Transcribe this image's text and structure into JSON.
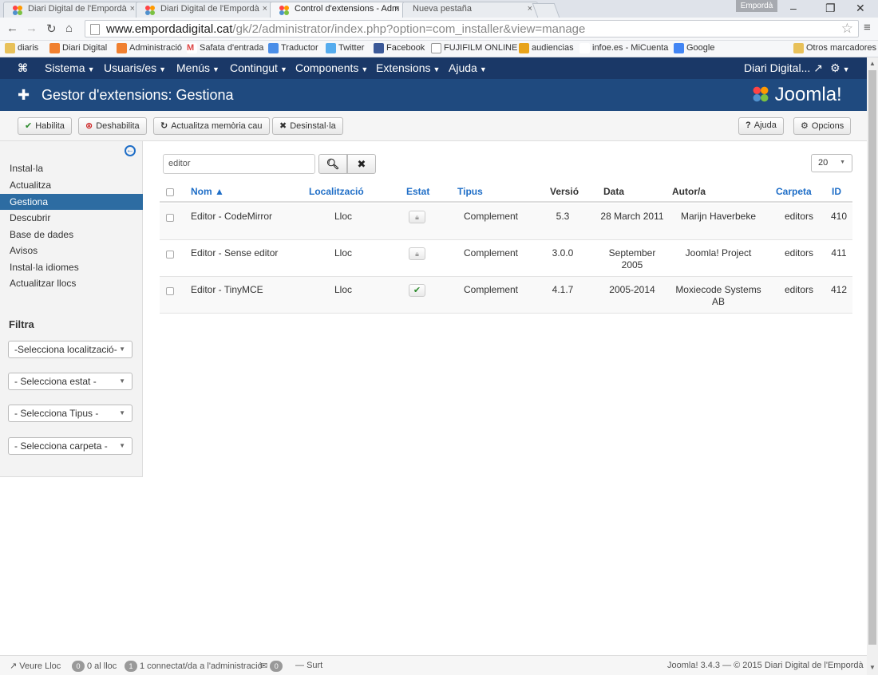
{
  "browser": {
    "tabs": [
      {
        "title": "Diari Digital de l'Empordà",
        "close": "×"
      },
      {
        "title": "Diari Digital de l'Empordà",
        "close": "×"
      },
      {
        "title": "Control d'extensions - Adm",
        "close": "×"
      },
      {
        "title": "Nueva pestaña",
        "close": "×"
      }
    ],
    "profile": "Empordà",
    "url_host": "www.empordadigital.cat",
    "url_path": "/gk/2/administrator/index.php?option=com_installer&view=manage",
    "bookmarks": [
      "diaris",
      "Diari Digital",
      "Administració",
      "Safata d'entrada",
      "Traductor",
      "Twitter",
      "Facebook",
      "FUJIFILM ONLINE",
      "audiencias",
      "infoe.es - MiCuenta",
      "Google"
    ],
    "other_bookmarks": "Otros marcadores"
  },
  "topnav": {
    "items": [
      "Sistema",
      "Usuaris/es",
      "Menús",
      "Contingut",
      "Components",
      "Extensions",
      "Ajuda"
    ],
    "site": "Diari Digital...",
    "gear": "⚙"
  },
  "header": {
    "title": "Gestor d'extensions: Gestiona",
    "logo": "Joomla!"
  },
  "toolbar": {
    "enable": "Habilita",
    "disable": "Deshabilita",
    "refresh": "Actualitza memòria cau",
    "uninstall": "Desinstal·la",
    "help": "Ajuda",
    "options": "Opcions"
  },
  "sidebar": {
    "items": [
      "Instal·la",
      "Actualitza",
      "Gestiona",
      "Descubrir",
      "Base de dades",
      "Avisos",
      "Instal·la idiomes",
      "Actualitzar llocs"
    ],
    "filter_label": "Filtra",
    "filters": [
      "-Selecciona localització-",
      "- Selecciona estat -",
      "- Selecciona Tipus -",
      "- Selecciona carpeta -"
    ]
  },
  "search": {
    "value": "editor",
    "limit": "20"
  },
  "table": {
    "headers": {
      "name": "Nom ▲",
      "location": "Localització",
      "status": "Estat",
      "type": "Tipus",
      "version": "Versió",
      "date": "Data",
      "author": "Autor/a",
      "folder": "Carpeta",
      "id": "ID"
    },
    "rows": [
      {
        "name": "Editor - CodeMirror",
        "location": "Lloc",
        "status": "locked",
        "type": "Complement",
        "version": "5.3",
        "date": "28 March 2011",
        "author": "Marijn Haverbeke",
        "folder": "editors",
        "id": "410"
      },
      {
        "name": "Editor - Sense editor",
        "location": "Lloc",
        "status": "locked",
        "type": "Complement",
        "version": "3.0.0",
        "date": "September 2005",
        "author": "Joomla! Project",
        "folder": "editors",
        "id": "411"
      },
      {
        "name": "Editor - TinyMCE",
        "location": "Lloc",
        "status": "enabled",
        "type": "Complement",
        "version": "4.1.7",
        "date": "2005-2014",
        "author": "Moxiecode Systems AB",
        "folder": "editors",
        "id": "412"
      }
    ]
  },
  "footer": {
    "view_site": "Veure Lloc",
    "visitors_count": "0",
    "visitors_label": "0 al lloc",
    "admins_count": "1",
    "admins_label": "1 connectat/da a l'administració",
    "messages_count": "0",
    "logout": "Surt",
    "version": "Joomla! 3.4.3 — © 2015 Diari Digital de l'Empordà"
  },
  "colors": {
    "nav": "#1a3867",
    "header": "#1f4a7f",
    "active": "#2d6ca2",
    "link": "#1f6ec7"
  }
}
